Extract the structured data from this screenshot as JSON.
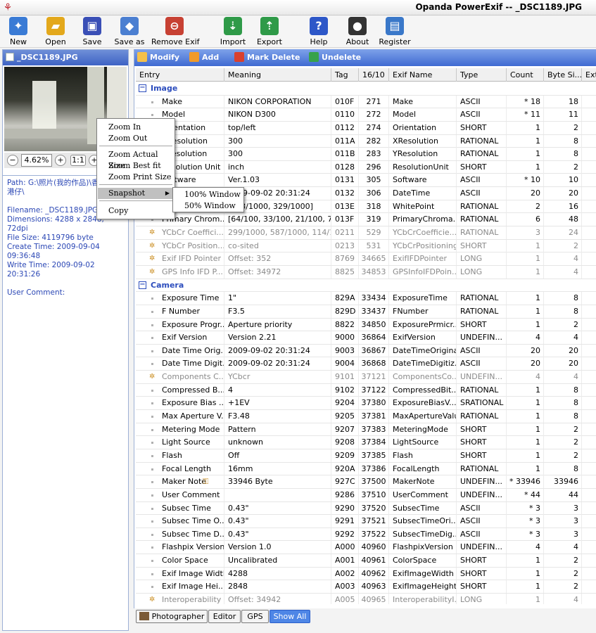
{
  "window": {
    "title": "Opanda PowerExif -- _DSC1189.JPG"
  },
  "toolbar": [
    {
      "label": "New",
      "icon": "new-file-icon",
      "color": "#3a7bd5",
      "glyph": "✦"
    },
    {
      "label": "Open",
      "icon": "open-folder-icon",
      "color": "#e3a81c",
      "glyph": "▰"
    },
    {
      "label": "Save",
      "icon": "save-disk-icon",
      "color": "#3a4fb6",
      "glyph": "▣"
    },
    {
      "label": "Save as",
      "icon": "save-as-icon",
      "color": "#4b7fd1",
      "glyph": "◆"
    },
    {
      "label": "Remove Exif",
      "icon": "remove-exif-icon",
      "color": "#c74133",
      "glyph": "⊖"
    },
    {
      "label": "Import",
      "icon": "import-icon",
      "color": "#2f9a48",
      "glyph": "⇣"
    },
    {
      "label": "Export",
      "icon": "export-icon",
      "color": "#2f9a48",
      "glyph": "⇡"
    },
    {
      "label": "Help",
      "icon": "help-icon",
      "color": "#2d57c8",
      "glyph": "?"
    },
    {
      "label": "About",
      "icon": "about-panda-icon",
      "color": "#333333",
      "glyph": "●"
    },
    {
      "label": "Register",
      "icon": "register-icon",
      "color": "#3a78c9",
      "glyph": "▤"
    }
  ],
  "left_pane": {
    "file_label": "_DSC1189.JPG",
    "zoom_value": "4.62%",
    "zoom_fit_label": "1:1",
    "info": {
      "path": "Path: G:\\照片(我的作品)\\香港\\",
      "path_suffix": "港仔\\",
      "filename": "Filename: _DSC1189.JPG",
      "dimensions": "Dimensions: 4288 x 2848, 72dpi",
      "filesize": "File Size: 4119796 byte",
      "create_time": "Create Time: 2009-09-04",
      "create_time2": "09:36:48",
      "write_time": "Write Time: 2009-09-02 20:31:26",
      "user_comment": "User Comment:"
    }
  },
  "actions": [
    {
      "label": "Modify",
      "icon": "modify-pencil-icon",
      "color": "#f4c04a"
    },
    {
      "label": "Add",
      "icon": "add-star-icon",
      "color": "#f09a2a"
    },
    {
      "label": "Mark Delete",
      "icon": "mark-delete-icon",
      "color": "#d9402f"
    },
    {
      "label": "Undelete",
      "icon": "undelete-icon",
      "color": "#37a24b"
    }
  ],
  "columns": [
    "Entry",
    "Meaning",
    "Tag",
    "16/10",
    "Exif Name",
    "Type",
    "Count",
    "Byte Si...",
    "Ext"
  ],
  "rows": [
    {
      "section": "Image"
    },
    {
      "entry": "Make",
      "meaning": "NIKON CORPORATION",
      "tag": "010F",
      "dec": "271",
      "name": "Make",
      "type": "ASCII",
      "count": "* 18",
      "bytes": "18"
    },
    {
      "entry": "Model",
      "meaning": "NIKON D300",
      "tag": "0110",
      "dec": "272",
      "name": "Model",
      "type": "ASCII",
      "count": "* 11",
      "bytes": "11"
    },
    {
      "entry": "Orientation",
      "meaning": "top/left",
      "tag": "0112",
      "dec": "274",
      "name": "Orientation",
      "type": "SHORT",
      "count": "1",
      "bytes": "2"
    },
    {
      "entry": "XResolution",
      "meaning": "300",
      "tag": "011A",
      "dec": "282",
      "name": "XResolution",
      "type": "RATIONAL",
      "count": "1",
      "bytes": "8"
    },
    {
      "entry": "YResolution",
      "meaning": "300",
      "tag": "011B",
      "dec": "283",
      "name": "YResolution",
      "type": "RATIONAL",
      "count": "1",
      "bytes": "8"
    },
    {
      "entry": "Resolution Unit",
      "meaning": "inch",
      "tag": "0128",
      "dec": "296",
      "name": "ResolutionUnit",
      "type": "SHORT",
      "count": "1",
      "bytes": "2"
    },
    {
      "entry": "Software",
      "meaning": "Ver.1.03",
      "tag": "0131",
      "dec": "305",
      "name": "Software",
      "type": "ASCII",
      "count": "* 10",
      "bytes": "10"
    },
    {
      "entry": "Date Time",
      "meaning": "2009-09-02 20:31:24",
      "tag": "0132",
      "dec": "306",
      "name": "DateTime",
      "type": "ASCII",
      "count": "20",
      "bytes": "20"
    },
    {
      "entry": "White Point",
      "meaning": "[313/1000, 329/1000]",
      "tag": "013E",
      "dec": "318",
      "name": "WhitePoint",
      "type": "RATIONAL",
      "count": "2",
      "bytes": "16"
    },
    {
      "entry": "Primary Chrom...",
      "meaning": "[64/100, 33/100, 21/100, 71...",
      "tag": "013F",
      "dec": "319",
      "name": "PrimaryChroma...",
      "type": "RATIONAL",
      "count": "6",
      "bytes": "48"
    },
    {
      "entry": "YCbCr Coeffici...",
      "meaning": "299/1000, 587/1000, 114/1...",
      "tag": "0211",
      "dec": "529",
      "name": "YCbCrCoefficie...",
      "type": "RATIONAL",
      "count": "3",
      "bytes": "24",
      "gray": true,
      "pointer": true
    },
    {
      "entry": "YCbCr Position...",
      "meaning": "co-sited",
      "tag": "0213",
      "dec": "531",
      "name": "YCbCrPositioning",
      "type": "SHORT",
      "count": "1",
      "bytes": "2",
      "gray": true,
      "pointer": true
    },
    {
      "entry": "Exif IFD Pointer",
      "meaning": "Offset: 352",
      "tag": "8769",
      "dec": "34665",
      "name": "ExifIFDPointer",
      "type": "LONG",
      "count": "1",
      "bytes": "4",
      "gray": true,
      "pointer": true
    },
    {
      "entry": "GPS Info IFD P...",
      "meaning": "Offset: 34972",
      "tag": "8825",
      "dec": "34853",
      "name": "GPSInfoIFDPoin...",
      "type": "LONG",
      "count": "1",
      "bytes": "4",
      "gray": true,
      "pointer": true
    },
    {
      "section": "Camera"
    },
    {
      "entry": "Exposure Time",
      "meaning": "1\"",
      "tag": "829A",
      "dec": "33434",
      "name": "ExposureTime",
      "type": "RATIONAL",
      "count": "1",
      "bytes": "8"
    },
    {
      "entry": "F Number",
      "meaning": "F3.5",
      "tag": "829D",
      "dec": "33437",
      "name": "FNumber",
      "type": "RATIONAL",
      "count": "1",
      "bytes": "8"
    },
    {
      "entry": "Exposure Progr...",
      "meaning": "Aperture priority",
      "tag": "8822",
      "dec": "34850",
      "name": "ExposurePrmicr...",
      "type": "SHORT",
      "count": "1",
      "bytes": "2"
    },
    {
      "entry": "Exif Version",
      "meaning": "Version 2.21",
      "tag": "9000",
      "dec": "36864",
      "name": "ExifVersion",
      "type": "UNDEFIN...",
      "count": "4",
      "bytes": "4"
    },
    {
      "entry": "Date Time Orig...",
      "meaning": "2009-09-02 20:31:24",
      "tag": "9003",
      "dec": "36867",
      "name": "DateTimeOriginal",
      "type": "ASCII",
      "count": "20",
      "bytes": "20"
    },
    {
      "entry": "Date Time Digit...",
      "meaning": "2009-09-02 20:31:24",
      "tag": "9004",
      "dec": "36868",
      "name": "DateTimeDigitiz...",
      "type": "ASCII",
      "count": "20",
      "bytes": "20"
    },
    {
      "entry": "Components C...",
      "meaning": "YCbcr",
      "tag": "9101",
      "dec": "37121",
      "name": "ComponentsCo...",
      "type": "UNDEFIN...",
      "count": "4",
      "bytes": "4",
      "gray": true,
      "pointer": true
    },
    {
      "entry": "Compressed B...",
      "meaning": "4",
      "tag": "9102",
      "dec": "37122",
      "name": "CompressedBit...",
      "type": "RATIONAL",
      "count": "1",
      "bytes": "8"
    },
    {
      "entry": "Exposure Bias ...",
      "meaning": "+1EV",
      "tag": "9204",
      "dec": "37380",
      "name": "ExposureBiasV...",
      "type": "SRATIONAL",
      "count": "1",
      "bytes": "8"
    },
    {
      "entry": "Max Aperture V...",
      "meaning": "F3.48",
      "tag": "9205",
      "dec": "37381",
      "name": "MaxApertureValue",
      "type": "RATIONAL",
      "count": "1",
      "bytes": "8"
    },
    {
      "entry": "Metering Mode",
      "meaning": "Pattern",
      "tag": "9207",
      "dec": "37383",
      "name": "MeteringMode",
      "type": "SHORT",
      "count": "1",
      "bytes": "2"
    },
    {
      "entry": "Light Source",
      "meaning": "unknown",
      "tag": "9208",
      "dec": "37384",
      "name": "LightSource",
      "type": "SHORT",
      "count": "1",
      "bytes": "2"
    },
    {
      "entry": "Flash",
      "meaning": "Off",
      "tag": "9209",
      "dec": "37385",
      "name": "Flash",
      "type": "SHORT",
      "count": "1",
      "bytes": "2"
    },
    {
      "entry": "Focal Length",
      "meaning": "16mm",
      "tag": "920A",
      "dec": "37386",
      "name": "FocalLength",
      "type": "RATIONAL",
      "count": "1",
      "bytes": "8"
    },
    {
      "entry": "Maker Note",
      "meaning": "33946 Byte",
      "tag": "927C",
      "dec": "37500",
      "name": "MakerNote",
      "type": "UNDEFIN...",
      "count": "* 33946",
      "bytes": "33946",
      "lock": true
    },
    {
      "entry": "User Comment",
      "meaning": "",
      "tag": "9286",
      "dec": "37510",
      "name": "UserComment",
      "type": "UNDEFIN...",
      "count": "* 44",
      "bytes": "44"
    },
    {
      "entry": "Subsec Time",
      "meaning": "0.43\"",
      "tag": "9290",
      "dec": "37520",
      "name": "SubsecTime",
      "type": "ASCII",
      "count": "* 3",
      "bytes": "3"
    },
    {
      "entry": "Subsec Time O...",
      "meaning": "0.43\"",
      "tag": "9291",
      "dec": "37521",
      "name": "SubsecTimeOri...",
      "type": "ASCII",
      "count": "* 3",
      "bytes": "3"
    },
    {
      "entry": "Subsec Time D...",
      "meaning": "0.43\"",
      "tag": "9292",
      "dec": "37522",
      "name": "SubsecTimeDig...",
      "type": "ASCII",
      "count": "* 3",
      "bytes": "3"
    },
    {
      "entry": "Flashpix Version",
      "meaning": "Version 1.0",
      "tag": "A000",
      "dec": "40960",
      "name": "FlashpixVersion",
      "type": "UNDEFIN...",
      "count": "4",
      "bytes": "4"
    },
    {
      "entry": "Color Space",
      "meaning": "Uncalibrated",
      "tag": "A001",
      "dec": "40961",
      "name": "ColorSpace",
      "type": "SHORT",
      "count": "1",
      "bytes": "2"
    },
    {
      "entry": "Exif Image Width",
      "meaning": "4288",
      "tag": "A002",
      "dec": "40962",
      "name": "ExifImageWidth",
      "type": "SHORT",
      "count": "1",
      "bytes": "2"
    },
    {
      "entry": "Exif Image Hei...",
      "meaning": "2848",
      "tag": "A003",
      "dec": "40963",
      "name": "ExifImageHeight",
      "type": "SHORT",
      "count": "1",
      "bytes": "2"
    },
    {
      "entry": "Interoperability ...",
      "meaning": "Offset: 34942",
      "tag": "A005",
      "dec": "40965",
      "name": "InteroperabilityI...",
      "type": "LONG",
      "count": "1",
      "bytes": "4",
      "gray": true,
      "pointer": true
    }
  ],
  "bottom_tabs": [
    {
      "label": "Photographer",
      "active": false
    },
    {
      "label": "Editor",
      "active": false
    },
    {
      "label": "GPS",
      "active": false
    },
    {
      "label": "Show All",
      "active": true
    }
  ],
  "context_menu": {
    "items": [
      "Zoom In",
      "Zoom Out",
      "Zoom Actual Size",
      "Zoom Best fit",
      "Zoom Print Size",
      "Snapshot",
      "Copy"
    ],
    "submenu": [
      "100% Window",
      "50% Window"
    ]
  }
}
